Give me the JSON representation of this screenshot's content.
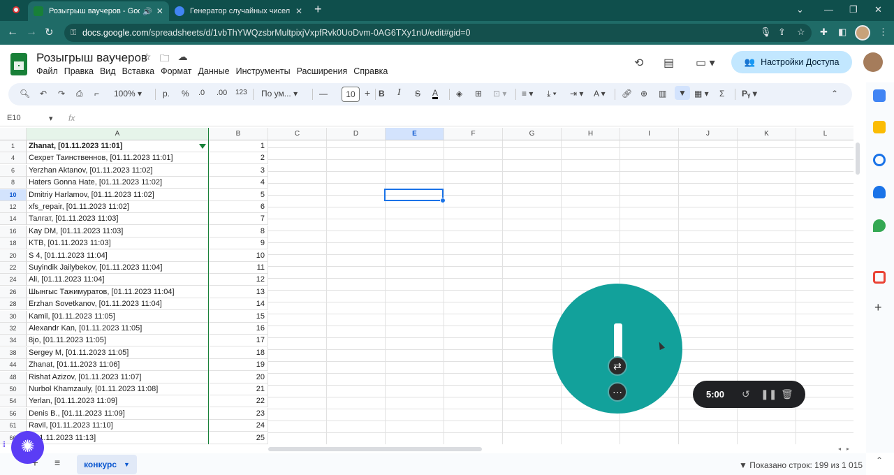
{
  "browser": {
    "tabs": [
      {
        "title": "Розыгрыш ваучеров - Goo",
        "fav": "#188038",
        "active": true
      },
      {
        "title": "Генератор случайных чисел | Р",
        "fav": "#4285f4",
        "active": false
      }
    ],
    "new_tab": "+",
    "url_host": "docs.google.com",
    "url_path": "/spreadsheets/d/1vbThYWQzsbrMultpixjVxpfRvk0UoDvm-0AG6TXy1nU/edit#gid=0"
  },
  "doc": {
    "title": "Розыгрыш ваучеров",
    "menus": [
      "Файл",
      "Правка",
      "Вид",
      "Вставка",
      "Формат",
      "Данные",
      "Инструменты",
      "Расширения",
      "Справка"
    ],
    "share_label": "Настройки Доступа"
  },
  "toolbar": {
    "zoom": "100%",
    "currency": "р.",
    "percent": "%",
    "dec_minus": ".0",
    "dec_plus": ".00",
    "number_format": "123",
    "font": "По ум...",
    "font_size": "10",
    "bold": "B",
    "italic": "I",
    "strike": "S",
    "text_color": "A"
  },
  "formula_bar": {
    "cell_ref": "E10",
    "fx": "fx"
  },
  "columns": [
    "A",
    "B",
    "C",
    "D",
    "E",
    "F",
    "G",
    "H",
    "I",
    "J",
    "K",
    "L"
  ],
  "rows": [
    {
      "n": "1",
      "a": "Zhanat, [01.11.2023 11:01]",
      "b": "1",
      "bold": true
    },
    {
      "n": "4",
      "a": "Сехрет Таинственнов, [01.11.2023 11:01]",
      "b": "2"
    },
    {
      "n": "6",
      "a": "Yerzhan Aktanov, [01.11.2023 11:02]",
      "b": "3"
    },
    {
      "n": "8",
      "a": "Haters Gonna Hate, [01.11.2023 11:02]",
      "b": "4"
    },
    {
      "n": "10",
      "a": "Dmitriy Harlamov, [01.11.2023 11:02]",
      "b": "5",
      "sel": true
    },
    {
      "n": "12",
      "a": "xfs_repair, [01.11.2023 11:02]",
      "b": "6"
    },
    {
      "n": "14",
      "a": "Талгат, [01.11.2023 11:03]",
      "b": "7"
    },
    {
      "n": "16",
      "a": "Kay DM, [01.11.2023 11:03]",
      "b": "8"
    },
    {
      "n": "18",
      "a": "KTB, [01.11.2023 11:03]",
      "b": "9"
    },
    {
      "n": "20",
      "a": "S 4, [01.11.2023 11:04]",
      "b": "10"
    },
    {
      "n": "22",
      "a": "Suyindik Jailybekov, [01.11.2023 11:04]",
      "b": "11"
    },
    {
      "n": "24",
      "a": "Ali, [01.11.2023 11:04]",
      "b": "12"
    },
    {
      "n": "26",
      "a": "Шынгыс Тажимуратов, [01.11.2023 11:04]",
      "b": "13"
    },
    {
      "n": "28",
      "a": "Erzhan Sovetkanov, [01.11.2023 11:04]",
      "b": "14"
    },
    {
      "n": "30",
      "a": "Kamil, [01.11.2023 11:05]",
      "b": "15"
    },
    {
      "n": "32",
      "a": "Alexandr Kan, [01.11.2023 11:05]",
      "b": "16"
    },
    {
      "n": "34",
      "a": "8jo, [01.11.2023 11:05]",
      "b": "17"
    },
    {
      "n": "38",
      "a": "Sergey M, [01.11.2023 11:05]",
      "b": "18"
    },
    {
      "n": "44",
      "a": "Zhanat, [01.11.2023 11:06]",
      "b": "19"
    },
    {
      "n": "48",
      "a": "Rishat Azizov, [01.11.2023 11:07]",
      "b": "20"
    },
    {
      "n": "50",
      "a": "Nurbol Khamzauly, [01.11.2023 11:08]",
      "b": "21"
    },
    {
      "n": "54",
      "a": "Yerlan, [01.11.2023 11:09]",
      "b": "22"
    },
    {
      "n": "56",
      "a": "Denis B., [01.11.2023 11:09]",
      "b": "23"
    },
    {
      "n": "61",
      "a": "Ravil, [01.11.2023 11:10]",
      "b": "24"
    },
    {
      "n": "66",
      "a": ", [01.11.2023 11:13]",
      "b": "25"
    }
  ],
  "sheet": {
    "tab_name": "конкурс",
    "status": "Показано строк: 199 из 1 015"
  },
  "timer": {
    "time": "5:00"
  }
}
